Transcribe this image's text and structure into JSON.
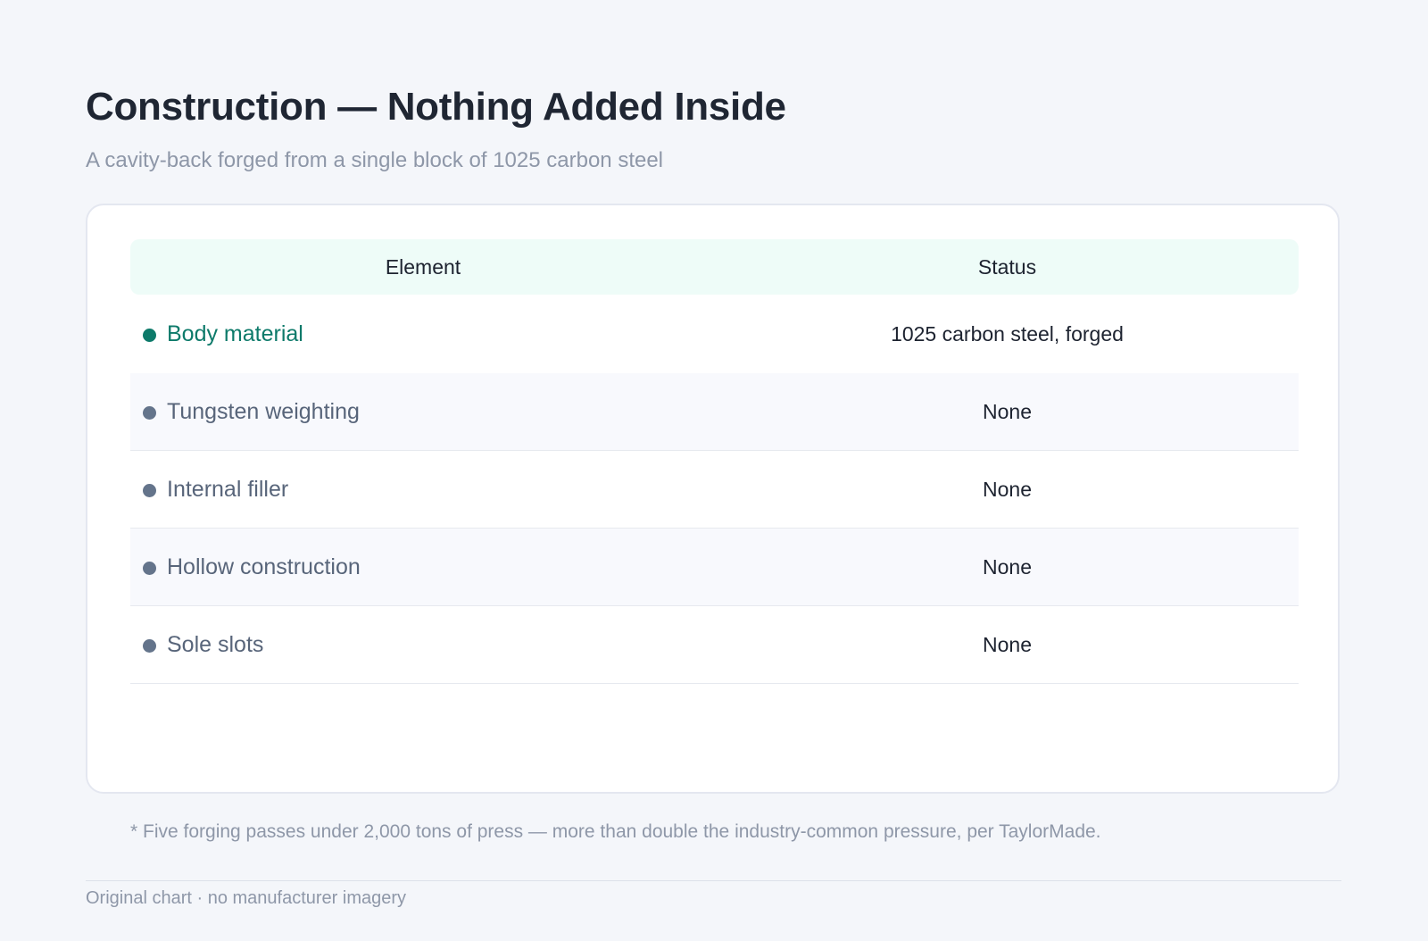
{
  "title": "Construction — Nothing Added Inside",
  "subtitle": "A cavity-back forged from a single block of 1025 carbon steel",
  "table": {
    "headers": {
      "element": "Element",
      "status": "Status"
    },
    "rows": [
      {
        "element": "Body material",
        "status": "1025 carbon steel, forged",
        "highlight": true
      },
      {
        "element": "Tungsten weighting",
        "status": "None",
        "highlight": false
      },
      {
        "element": "Internal filler",
        "status": "None",
        "highlight": false
      },
      {
        "element": "Hollow construction",
        "status": "None",
        "highlight": false
      },
      {
        "element": "Sole slots",
        "status": "None",
        "highlight": false
      }
    ]
  },
  "footnote": "* Five forging passes under 2,000 tons of press — more than double the industry-common pressure, per TaylorMade.",
  "footer": "Original chart · no manufacturer imagery",
  "colors": {
    "accent": "#0d7a6a",
    "muted_dot": "#64748b",
    "header_bg": "#eefcf8"
  }
}
